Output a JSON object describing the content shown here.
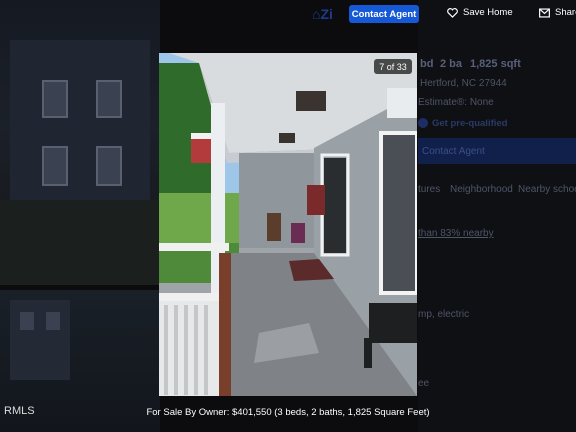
{
  "header": {
    "logo_text": "Zi",
    "contact_agent_label": "Contact Agent",
    "save_home_label": "Save Home",
    "share_label": "Share"
  },
  "gallery": {
    "counter": "7 of 33",
    "caption": "For Sale By Owner: $401,550 (3 beds, 2 baths, 1,825 Square Feet)",
    "source_label": "RMLS"
  },
  "listing_bg": {
    "beds": "bd",
    "baths": "2 ba",
    "sqft": "1,825 sqft",
    "address": "Hertford, NC 27944",
    "zestimate": "Estimate®: None",
    "prequal": "Get pre-qualified",
    "contact_agent": "Contact Agent",
    "tabs": [
      "tures",
      "Neighborhood",
      "Nearby schoo"
    ],
    "nearby": "than 83% nearby",
    "heating": "mp, electric",
    "fee": "ee"
  },
  "colors": {
    "accent": "#1659d6",
    "page_bg": "#0c0c0f"
  }
}
